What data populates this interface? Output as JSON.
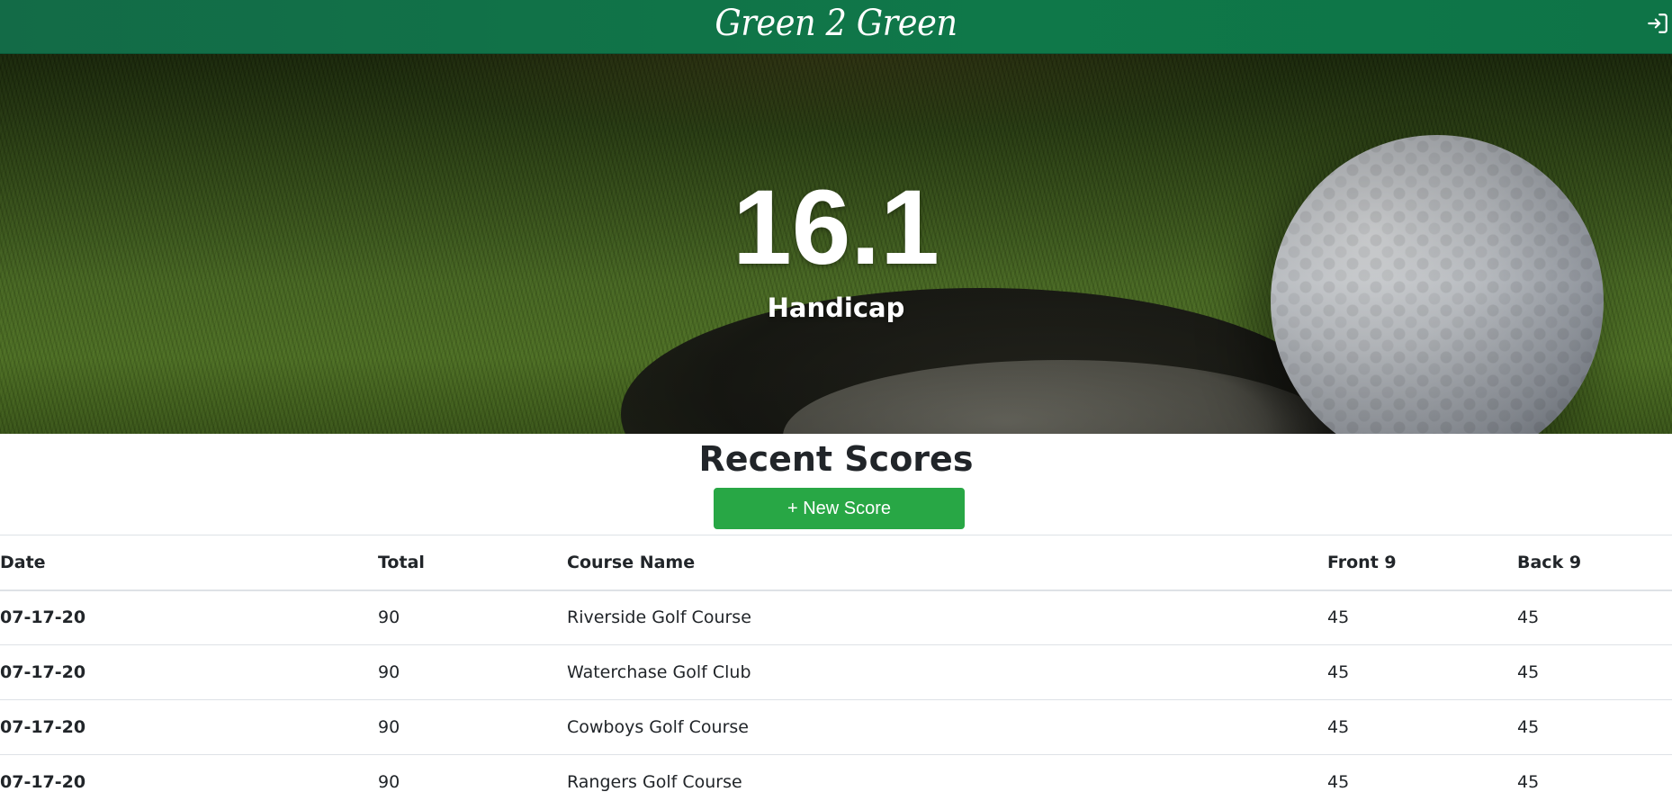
{
  "navbar": {
    "brand": "Green 2 Green",
    "logout_icon": "sign-out-icon",
    "bg_color": "#0f7849"
  },
  "hero": {
    "handicap_value": "16.1",
    "handicap_label": "Handicap"
  },
  "scores": {
    "title": "Recent Scores",
    "new_score_label": "+ New Score",
    "button_color": "#28a745",
    "columns": [
      "Date",
      "Total",
      "Course Name",
      "Front 9",
      "Back 9"
    ],
    "rows": [
      {
        "date": "07-17-20",
        "total": "90",
        "course": "Riverside Golf Course",
        "front": "45",
        "back": "45"
      },
      {
        "date": "07-17-20",
        "total": "90",
        "course": "Waterchase Golf Club",
        "front": "45",
        "back": "45"
      },
      {
        "date": "07-17-20",
        "total": "90",
        "course": "Cowboys Golf Course",
        "front": "45",
        "back": "45"
      },
      {
        "date": "07-17-20",
        "total": "90",
        "course": "Rangers Golf Course",
        "front": "45",
        "back": "45"
      }
    ]
  }
}
